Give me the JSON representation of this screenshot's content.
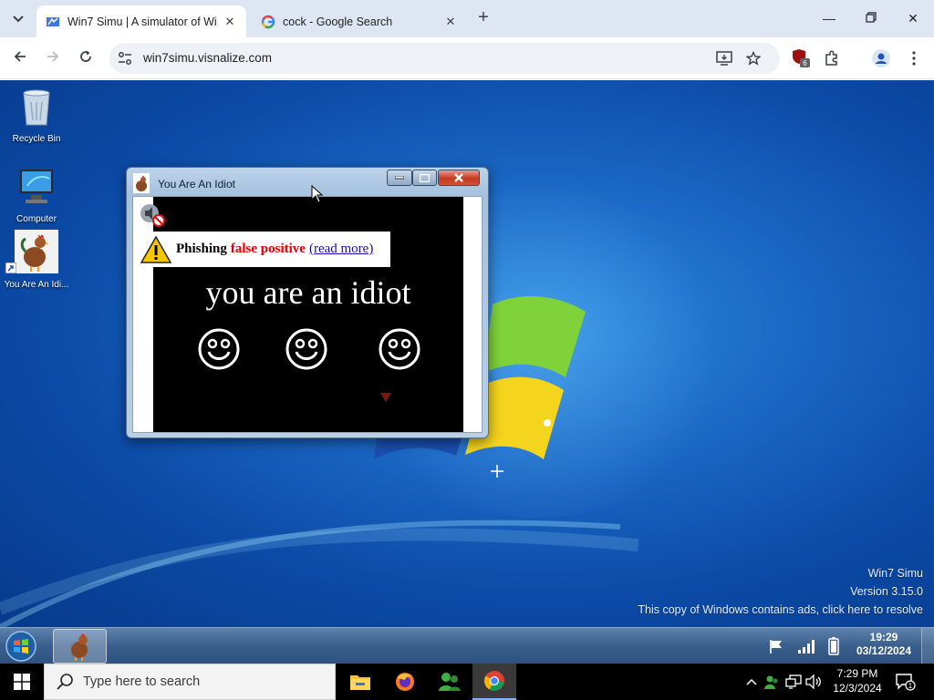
{
  "browser": {
    "tabs": [
      {
        "title": "Win7 Simu | A simulator of Wind",
        "active": true
      },
      {
        "title": "cock - Google Search",
        "active": false
      }
    ],
    "url": "win7simu.visnalize.com",
    "extension_badge": "6"
  },
  "desktop": {
    "icons": [
      {
        "label": "Recycle Bin",
        "icon": "recycle-bin-icon"
      },
      {
        "label": "Computer",
        "icon": "computer-icon"
      },
      {
        "label": "You Are An Idi...",
        "icon": "chicken-app-icon"
      }
    ],
    "watermark": {
      "line1": "Win7 Simu",
      "line2": "Version 3.15.0",
      "line3": "This copy of Windows contains ads, click here to resolve"
    }
  },
  "popup": {
    "title": "You Are An Idiot",
    "main_text": "you are an idiot",
    "smiley_count": 3,
    "banner": {
      "word1": "Phishing",
      "word2": "false positive",
      "link": "(read more)"
    },
    "colors": {
      "warning_red": "#e00000",
      "link_blue": "#1a0dab"
    }
  },
  "w7_taskbar": {
    "clock_time": "19:29",
    "clock_date": "03/12/2024"
  },
  "w10_taskbar": {
    "search_placeholder": "Type here to search",
    "clock_time": "7:29 PM",
    "clock_date": "12/3/2024",
    "notification_count": "1"
  }
}
